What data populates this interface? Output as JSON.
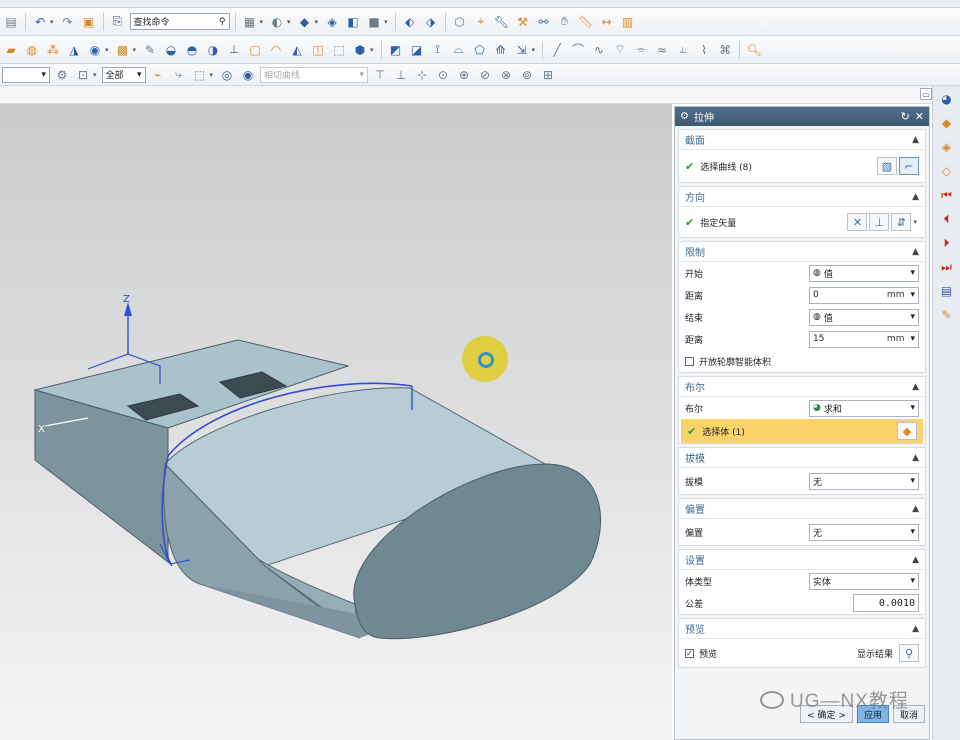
{
  "toolbar": {
    "command_search_placeholder": "查找命令",
    "type_filter": "全部",
    "snap_filter": "相切曲线"
  },
  "viewport": {
    "axes": {
      "z_label": "Z",
      "x_label": "X"
    }
  },
  "dialog": {
    "title": "拉伸",
    "section": {
      "header": "截面",
      "select_curve": "选择曲线 (8)"
    },
    "direction": {
      "header": "方向",
      "specify_vector": "指定矢量"
    },
    "limits": {
      "header": "限制",
      "start_label": "开始",
      "start_value": "值",
      "distance1_label": "距离",
      "distance1_value": "0",
      "distance1_unit": "mm",
      "end_label": "结束",
      "end_value": "值",
      "distance2_label": "距离",
      "distance2_value": "15",
      "distance2_unit": "mm",
      "open_profile_label": "开放轮廓智能体积"
    },
    "boolean": {
      "header": "布尔",
      "boolean_label": "布尔",
      "boolean_value": "求和",
      "select_body": "选择体 (1)"
    },
    "draft": {
      "header": "拔模",
      "draft_label": "拔模",
      "draft_value": "无"
    },
    "offset": {
      "header": "偏置",
      "offset_label": "偏置",
      "offset_value": "无"
    },
    "settings": {
      "header": "设置",
      "body_type_label": "体类型",
      "body_type_value": "实体",
      "tolerance_label": "公差",
      "tolerance_value": "0.0010"
    },
    "preview": {
      "header": "预览",
      "preview_label": "预览",
      "show_result_label": "显示结果"
    },
    "buttons": {
      "ok": "< 确定 >",
      "apply": "应用",
      "cancel": "取消"
    }
  },
  "watermark": "UG—NX教程",
  "colors": {
    "title_bar": "#3d5a73",
    "section_header": "#3f6b93",
    "highlight_row": "#fbd36b",
    "model_face": "#a9c2cc",
    "model_side": "#8fa9b3",
    "curve": "#2f4fcf",
    "check": "#21a03c"
  }
}
